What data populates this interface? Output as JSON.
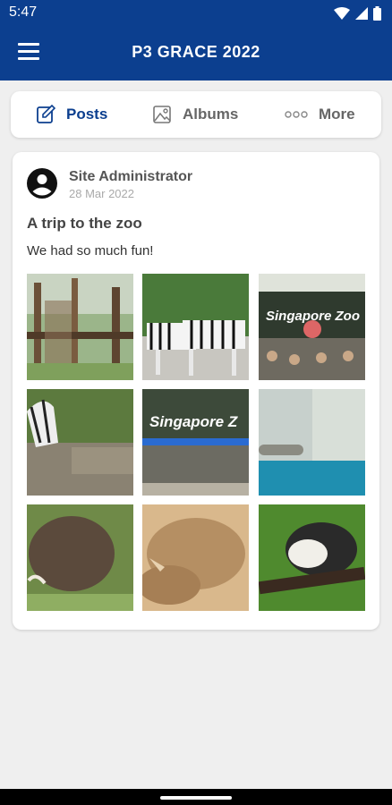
{
  "status_bar": {
    "time": "5:47"
  },
  "app_bar": {
    "title": "P3 GRACE 2022"
  },
  "tabs": [
    {
      "label": "Posts",
      "icon": "edit-icon",
      "active": true
    },
    {
      "label": "Albums",
      "icon": "image-icon",
      "active": false
    },
    {
      "label": "More",
      "icon": "more-dots-icon",
      "active": false
    }
  ],
  "post": {
    "author": "Site Administrator",
    "date": "28 Mar 2022",
    "title": "A trip to the zoo",
    "body": "We had so much fun!",
    "photos": [
      {
        "subject": "trees-and-enclosure"
      },
      {
        "subject": "zebras"
      },
      {
        "subject": "zoo-entrance-sign",
        "sign_text": "Singapore Zoo"
      },
      {
        "subject": "zebra-on-rocks"
      },
      {
        "subject": "zoo-entrance-gate",
        "sign_text": "Singapore Z"
      },
      {
        "subject": "aquarium-pool"
      },
      {
        "subject": "warthog"
      },
      {
        "subject": "rhinoceros"
      },
      {
        "subject": "monkey-on-branch"
      }
    ]
  },
  "colors": {
    "primary": "#0c3f8f",
    "background": "#efefef",
    "card": "#ffffff"
  }
}
